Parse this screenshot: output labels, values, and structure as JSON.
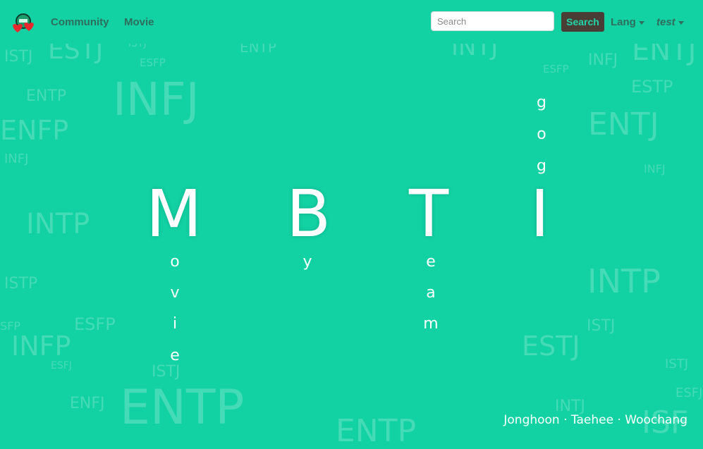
{
  "nav": {
    "links": [
      "Community",
      "Movie"
    ],
    "search_placeholder": "Search",
    "search_button": "Search",
    "lang_label": "Lang",
    "user_label": "test"
  },
  "hero": {
    "letters": [
      "M",
      "B",
      "T",
      "I"
    ],
    "m_word": [
      "o",
      "v",
      "i",
      "e"
    ],
    "b_word": [
      "y"
    ],
    "t_word": [
      "e",
      "a",
      "m"
    ],
    "i_word": [
      "g",
      "o",
      "g"
    ]
  },
  "background_words": [
    "ISTJ",
    "ESTJ",
    "ISTJ",
    "ESFP",
    "ENTP",
    "INTJ",
    "ENTJ",
    "ESFP",
    "INFJ",
    "ENTP",
    "INFJ",
    "ESTP",
    "ENFP",
    "ENTJ",
    "INFJ",
    "INFJ",
    "INTP",
    "INTP",
    "ISTP",
    "ISTJ",
    "ESFP",
    "SFP",
    "INFP",
    "ESTJ",
    "ESFJ",
    "ISTJ",
    "ISTJ",
    "ESFJ",
    "ENFJ",
    "ENTP",
    "INTJ",
    "ENTP",
    "ISF"
  ],
  "footer": {
    "credits": "Jonghoon · Taehee · Woochang"
  },
  "colors": {
    "background": "#12d1a3",
    "search_button_bg": "#4a3d35",
    "search_button_text": "#1fd6a8",
    "nav_text": "#2f6d5e"
  }
}
